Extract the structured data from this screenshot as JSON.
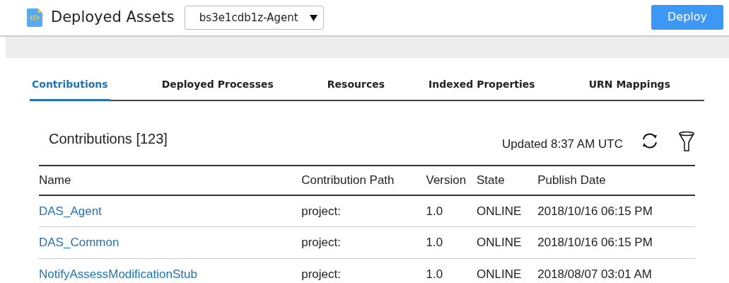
{
  "header": {
    "title": "Deployed Assets",
    "agent_select": {
      "value": "bs3e1cdb1z-Agent"
    },
    "deploy_button": "Deploy"
  },
  "tabs": [
    {
      "label": "Contributions",
      "selected": true
    },
    {
      "label": "Deployed Processes",
      "selected": false
    },
    {
      "label": "Resources",
      "selected": false
    },
    {
      "label": "Indexed Properties",
      "selected": false
    },
    {
      "label": "URN Mappings",
      "selected": false
    }
  ],
  "section": {
    "title": "Contributions [123]",
    "updated": "Updated 8:37 AM UTC"
  },
  "table": {
    "columns": [
      "Name",
      "Contribution Path",
      "Version",
      "State",
      "Publish Date"
    ],
    "rows": [
      {
        "name": "DAS_Agent",
        "path": "project:",
        "version": "1.0",
        "state": "ONLINE",
        "date": "2018/10/16 06:15 PM"
      },
      {
        "name": "DAS_Common",
        "path": "project:",
        "version": "1.0",
        "state": "ONLINE",
        "date": "2018/10/16 06:15 PM"
      },
      {
        "name": "NotifyAssessModificationStub",
        "path": "project:",
        "version": "1.0",
        "state": "ONLINE",
        "date": "2018/08/07 03:01 AM"
      }
    ]
  }
}
